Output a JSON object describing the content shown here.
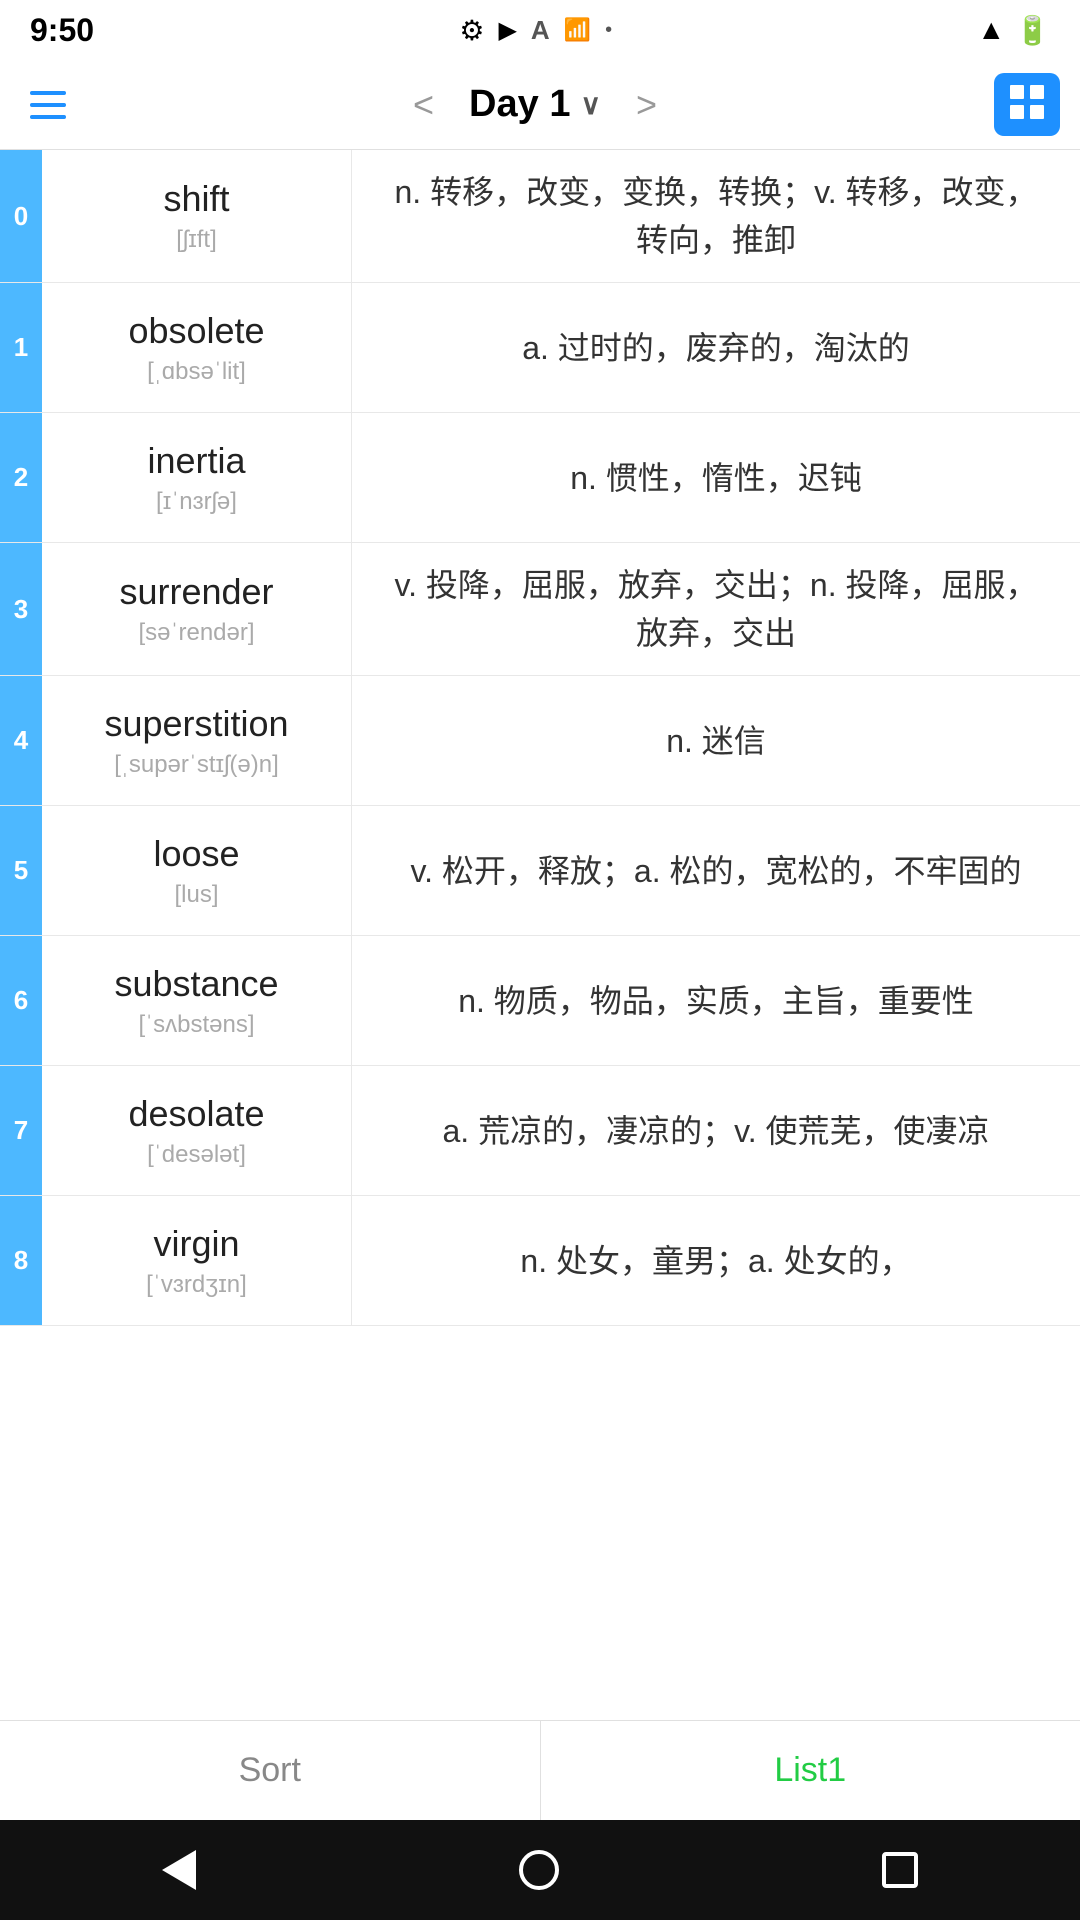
{
  "statusBar": {
    "time": "9:50",
    "icons": [
      "gear",
      "play",
      "text",
      "wifi",
      "dot"
    ]
  },
  "navBar": {
    "title": "Day 1",
    "prevArrow": "<",
    "nextArrow": ">"
  },
  "words": [
    {
      "index": "0",
      "english": "shift",
      "phonetic": "[ʃɪft]",
      "definition": "n. 转移，改变，变换，转换；v. 转移，改变，转向，推卸"
    },
    {
      "index": "1",
      "english": "obsolete",
      "phonetic": "[ˌɑbsəˈlit]",
      "definition": "a. 过时的，废弃的，淘汰的"
    },
    {
      "index": "2",
      "english": "inertia",
      "phonetic": "[ɪˈnɜrʃə]",
      "definition": "n. 惯性，惰性，迟钝"
    },
    {
      "index": "3",
      "english": "surrender",
      "phonetic": "[səˈrendər]",
      "definition": "v. 投降，屈服，放弃，交出；n. 投降，屈服，放弃，交出"
    },
    {
      "index": "4",
      "english": "superstition",
      "phonetic": "[ˌsupərˈstɪʃ(ə)n]",
      "definition": "n. 迷信"
    },
    {
      "index": "5",
      "english": "loose",
      "phonetic": "[lus]",
      "definition": "v. 松开，释放；a. 松的，宽松的，不牢固的"
    },
    {
      "index": "6",
      "english": "substance",
      "phonetic": "[ˈsʌbstəns]",
      "definition": "n. 物质，物品，实质，主旨，重要性"
    },
    {
      "index": "7",
      "english": "desolate",
      "phonetic": "[ˈdesələt]",
      "definition": "a. 荒凉的，凄凉的；v. 使荒芜，使凄凉"
    },
    {
      "index": "8",
      "english": "virgin",
      "phonetic": "[ˈvɜrdʒɪn]",
      "definition": "n. 处女，童男；a. 处女的，"
    }
  ],
  "bottomTabs": {
    "sort": "Sort",
    "list1": "List1"
  },
  "androidNav": {
    "back": "◀",
    "home": "●",
    "recents": "■"
  }
}
